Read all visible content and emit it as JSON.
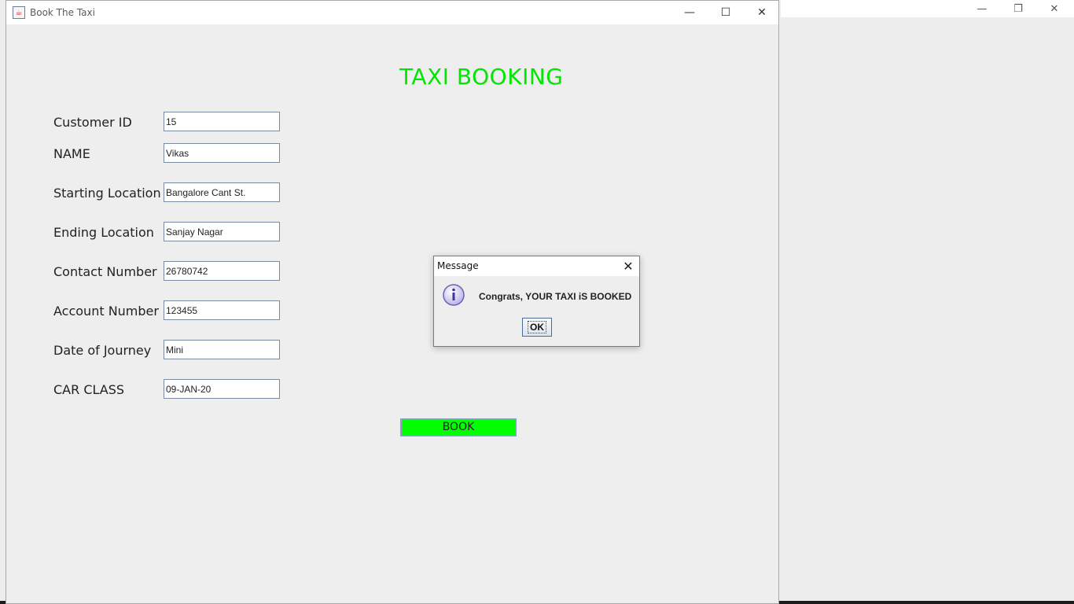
{
  "window": {
    "title": "Book The Taxi",
    "controls": {
      "minimize": "—",
      "maximize": "☐",
      "close": "✕"
    }
  },
  "background_window": {
    "controls": {
      "minimize": "—",
      "restore": "❐",
      "close": "✕"
    }
  },
  "form": {
    "heading": "TAXI BOOKING",
    "fields": [
      {
        "label": "Customer ID",
        "value": "15"
      },
      {
        "label": "NAME",
        "value": "Vikas"
      },
      {
        "label": "Starting Location",
        "value": "Bangalore Cant St."
      },
      {
        "label": "Ending Location",
        "value": "Sanjay Nagar"
      },
      {
        "label": "Contact Number",
        "value": "26780742"
      },
      {
        "label": "Account Number",
        "value": "123455"
      },
      {
        "label": "Date of Journey",
        "value": "Mini"
      },
      {
        "label": "CAR CLASS",
        "value": "09-JAN-20"
      }
    ],
    "book_label": "BOOK",
    "book_color": "#00ff00",
    "heading_color": "#00e600"
  },
  "dialog": {
    "title": "Message",
    "close_glyph": "✕",
    "icon": "info-icon",
    "message": "Congrats, YOUR TAXI iS BOOKED",
    "ok_label": "OK"
  }
}
